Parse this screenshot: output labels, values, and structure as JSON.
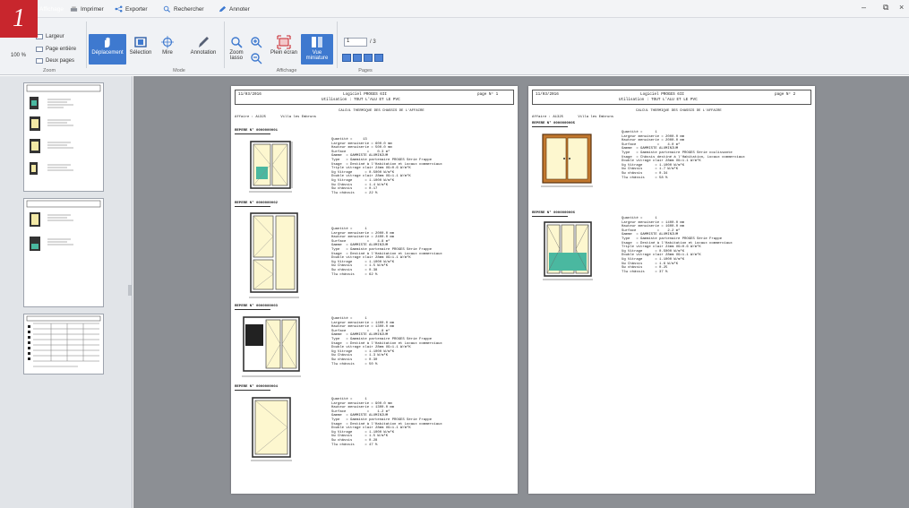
{
  "badge": "1",
  "tabs": [
    {
      "label": "Affichage"
    },
    {
      "label": "Imprimer"
    },
    {
      "label": "Exporter"
    },
    {
      "label": "Rechercher"
    },
    {
      "label": "Annoter"
    }
  ],
  "ribbon": {
    "zoom_value": "100 %",
    "largeur": "Largeur",
    "page_entiere": "Page entière",
    "deux_pages": "Deux pages",
    "group_zoom": "Zoom",
    "deplacement": "Déplacement",
    "selection": "Sélection",
    "mire": "Mire",
    "annotation": "Annotation",
    "group_mode": "Mode",
    "zoom_lasso": "Zoom lasso",
    "plein_ecran": "Plein écran",
    "vue_miniature": "Vue miniature",
    "group_affichage": "Affichage",
    "page_current": "1",
    "page_total": "/ 3",
    "group_pages": "Pages"
  },
  "window": {
    "minimize": "–",
    "restore": "⧉",
    "close": "×"
  },
  "page1": {
    "date": "11/03/2016",
    "software": "Logiciel PROGES 6II",
    "usage": "Utilisation : TOUT L'ALU ET LE PVC",
    "page_no": "page N°  1",
    "title": "CALCUL THERMIQUE DES CHASSIS DE L'AFFAIRE",
    "affaire": "Affaire : A1325       Villa les Embruns",
    "repere1": "REPERE N° 0000000001",
    "block1": "Quantité =     13\nLargeur menuiserie = 600.0 mm\nHauteur menuiserie = 500.0 mm\nSurface          =    0.3 m²\nGamme  = GAMMISTE ALUMINIUM\nType   = Gammiste partenaire PROGES Série Frappe\nUsage  = Destiné à l'Habitation et Locaux commerciaux\nTriple vitrage clair 24mm UG=0.6 W/m²K\nUg Vitrage      = 0.5000 W/m²K\nDouble vitrage clair 28mm UG=1.1 W/m²K\nUg Vitrage      = 1.1000 W/m²K\nUw Châssis      = 1.4 W/m²K\nSw châssis      = 0.17\nTlw châssis     = 22 %",
    "repere2": "REPERE N° 0000000002",
    "block2": "Quantité =      1\nLargeur menuiserie = 2000.0 mm\nHauteur menuiserie = 2400.0 mm\nSurface          =    4.8 m²\nGamme  = GAMMISTE ALUMINIUM\nType   = Gammiste partenaire PROGES Série Frappe\nUsage  = Destiné à l'Habitation et Locaux commerciaux\nDouble vitrage clair 28mm UG=1.1 W/m²K\nUg Vitrage      = 1.1000 W/m²K\nUw Châssis      = 1.5 W/m²K\nSw châssis      = 0.38\nTlw châssis     = 62 %",
    "repere3": "REPERE N° 0000000003",
    "block3": "Quantité =      1\nLargeur menuiserie = 1400.0 mm\nHauteur menuiserie = 1300.0 mm\nSurface          =    1.8 m²\nGamme  = GAMMISTE ALUMINIUM\nType   = Gammiste partenaire PROGES Série Frappe\nUsage  = Destiné à l'Habitation et Locaux commerciaux\nDouble vitrage clair 28mm UG=1.1 W/m²K\nUg Vitrage      = 1.1000 W/m²K\nUw Châssis      = 1.3 W/m²K\nSw châssis      = 0.30\nTlw châssis     = 50 %",
    "repere4": "REPERE N° 0000000004",
    "block4": "Quantité =      1\nLargeur menuiserie = 900.0 mm\nHauteur menuiserie = 1300.0 mm\nSurface          =    1.2 m²\nGamme  = GAMMISTE ALUMINIUM\nType   = Gammiste partenaire PROGES Série Frappe\nUsage  = Destiné à l'Habitation et Locaux commerciaux\nDouble vitrage clair 28mm UG=1.1 W/m²K\nUg Vitrage      = 1.1000 W/m²K\nUw Châssis      = 1.5 W/m²K\nSw châssis      = 0.28\nTlw châssis     = 47 %"
  },
  "page2": {
    "date": "11/03/2016",
    "software": "Logiciel PROGES 6II",
    "usage": "Utilisation : TOUT L'ALU ET LE PVC",
    "page_no": "page N°  2",
    "title": "CALCUL THERMIQUE DES CHASSIS DE L'AFFAIRE",
    "affaire": "Affaire : A1325       Villa les Embruns",
    "repere1": "REPERE N° 0000000005",
    "block1": "Quantité =      1\nLargeur menuiserie = 2000.0 mm\nHauteur menuiserie = 2000.0 mm\nSurface          =    4.0 m²\nGamme  = GAMMISTE ALUMINIUM\nType   = Gammiste partenaire PROGES Série coulissante\nUsage  = Châssis destiné à l'Habitation, Locaux commerciaux\nDouble vitrage clair 28mm UG=1.1 W/m²K\nUg Vitrage      = 1.1000 W/m²K\nUw Châssis      = 1.7 W/m²K\nSw châssis      = 0.34\nTlw châssis     = 58 %",
    "repere2": "REPERE N° 0000000006",
    "block2": "Quantité =      1\nLargeur menuiserie = 1400.0 mm\nHauteur menuiserie = 1600.0 mm\nSurface          =    2.2 m²\nGamme  = GAMMISTE ALUMINIUM\nType   = Gammiste partenaire PROGES Série Frappe\nUsage  = Destiné à l'Habitation et Locaux commerciaux\nTriple vitrage clair 24mm UG=0.6 W/m²K\nUg Vitrage      = 0.5000 W/m²K\nDouble vitrage clair 28mm UG=1.1 W/m²K\nUg Vitrage      = 1.1000 W/m²K\nUw Châssis      = 1.6 W/m²K\nSw châssis      = 0.25\nTlw châssis     = 37 %"
  }
}
